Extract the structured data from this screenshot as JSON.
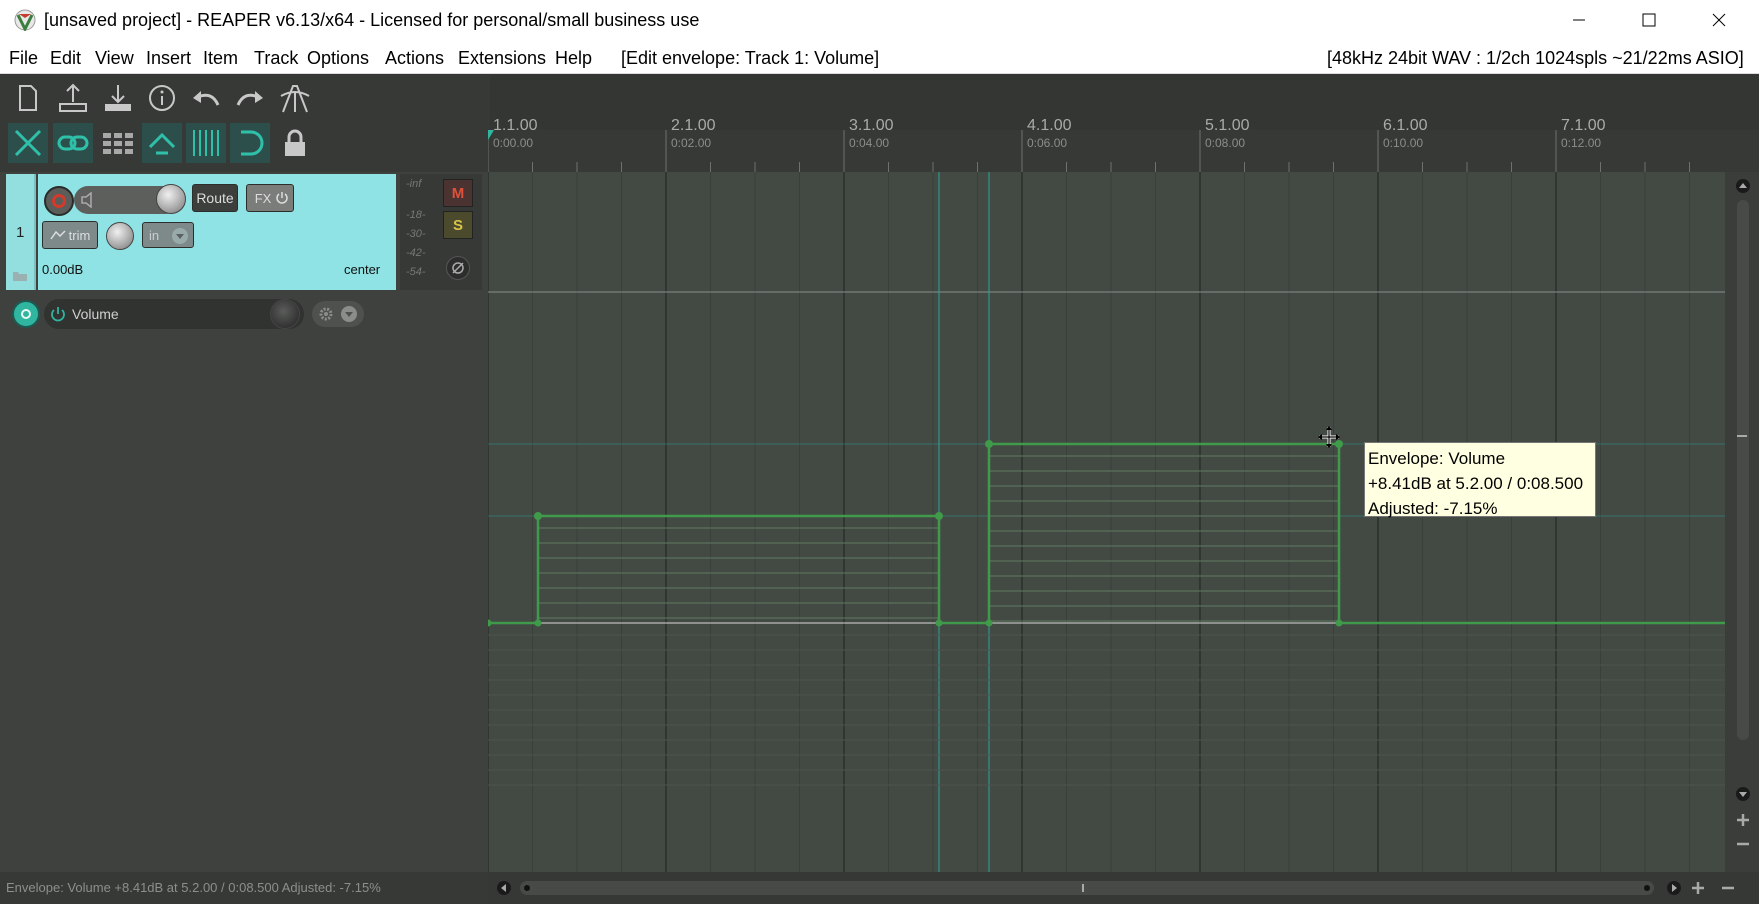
{
  "window": {
    "title": "[unsaved project] - REAPER v6.13/x64 - Licensed for personal/small business use",
    "minimize_icon": "minimize-icon",
    "maximize_icon": "maximize-icon",
    "close_icon": "close-icon"
  },
  "menu": {
    "items": [
      "File",
      "Edit",
      "View",
      "Insert",
      "Item",
      "Track",
      "Options",
      "Actions",
      "Extensions",
      "Help"
    ],
    "context": "[Edit envelope: Track 1: Volume]",
    "audio_status": "[48kHz 24bit WAV : 1/2ch 1024spls ~21/22ms ASIO]"
  },
  "toolbar": {
    "row1": [
      "new-project-icon",
      "open-project-icon",
      "save-project-icon",
      "project-info-icon",
      "undo-icon",
      "redo-icon",
      "metronome-icon"
    ],
    "row2": [
      "ripple-editing-icon",
      "item-grouping-icon",
      "snap-grid-icon",
      "envelope-points-move-icon",
      "grid-lines-icon",
      "loop-auto-icon",
      "lock-icon"
    ]
  },
  "track": {
    "number": "1",
    "route_label": "Route",
    "fx_label": "FX",
    "trim_label": "trim",
    "input_label": "in",
    "volume_readout": "0.00dB",
    "pan_readout": "center",
    "mute_label": "M",
    "solo_label": "S",
    "meter_labels": [
      "-inf",
      "-18-",
      "-30-",
      "-42-",
      "-54-"
    ]
  },
  "envelope_lane": {
    "name": "Volume"
  },
  "ruler": {
    "marks": [
      {
        "bar": "1.1.00",
        "time": "0:00.00"
      },
      {
        "bar": "2.1.00",
        "time": "0:02.00"
      },
      {
        "bar": "3.1.00",
        "time": "0:04.00"
      },
      {
        "bar": "4.1.00",
        "time": "0:06.00"
      },
      {
        "bar": "5.1.00",
        "time": "0:08.00"
      },
      {
        "bar": "6.1.00",
        "time": "0:10.00"
      },
      {
        "bar": "7.1.00",
        "time": "0:12.00"
      }
    ]
  },
  "tooltip": {
    "line1": "Envelope: Volume",
    "line2": "+8.41dB at 5.2.00 / 0:08.500",
    "line3": "Adjusted: -7.15%"
  },
  "status": {
    "text": "Envelope: Volume +8.41dB at 5.2.00 / 0:08.500 Adjusted: -7.15%"
  },
  "colors": {
    "envelope": "#3f9a4a",
    "track": "#93dfe0",
    "accent": "#2fb5a0"
  }
}
